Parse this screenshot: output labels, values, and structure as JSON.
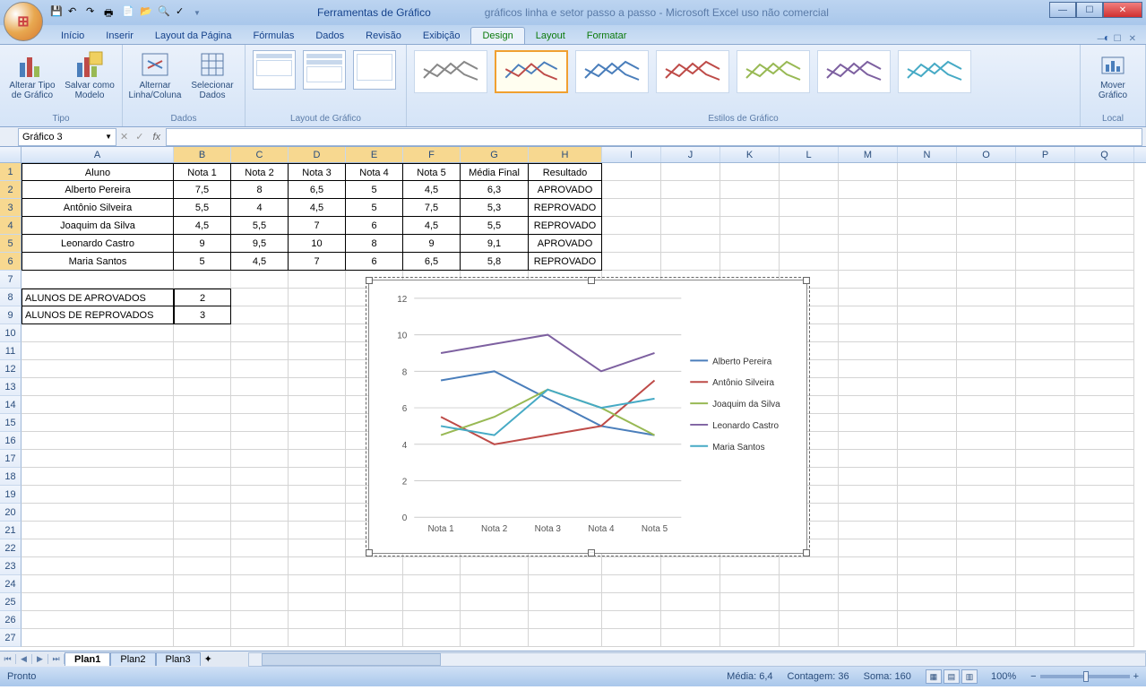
{
  "window": {
    "tools_title": "Ferramentas de Gráfico",
    "doc_title": "gráficos linha e setor passo a passo - Microsoft Excel uso não comercial"
  },
  "tabs": {
    "inicio": "Início",
    "inserir": "Inserir",
    "layout_pagina": "Layout da Página",
    "formulas": "Fórmulas",
    "dados": "Dados",
    "revisao": "Revisão",
    "exibicao": "Exibição",
    "design": "Design",
    "layout": "Layout",
    "formatar": "Formatar"
  },
  "ribbon": {
    "tipo": "Tipo",
    "alterar_tipo": "Alterar Tipo de Gráfico",
    "salvar_modelo": "Salvar como Modelo",
    "dados_lbl": "Dados",
    "alternar": "Alternar Linha/Coluna",
    "selecionar": "Selecionar Dados",
    "layout_grafico": "Layout de Gráfico",
    "estilos": "Estilos de Gráfico",
    "local": "Local",
    "mover": "Mover Gráfico"
  },
  "namebox": "Gráfico 3",
  "columns": [
    "A",
    "B",
    "C",
    "D",
    "E",
    "F",
    "G",
    "H",
    "I",
    "J",
    "K",
    "L",
    "M",
    "N",
    "O",
    "P",
    "Q"
  ],
  "grid": {
    "headers": [
      "Aluno",
      "Nota 1",
      "Nota 2",
      "Nota 3",
      "Nota 4",
      "Nota 5",
      "Média Final",
      "Resultado"
    ],
    "rows": [
      [
        "Alberto Pereira",
        "7,5",
        "8",
        "6,5",
        "5",
        "4,5",
        "6,3",
        "APROVADO"
      ],
      [
        "Antônio Silveira",
        "5,5",
        "4",
        "4,5",
        "5",
        "7,5",
        "5,3",
        "REPROVADO"
      ],
      [
        "Joaquim da Silva",
        "4,5",
        "5,5",
        "7",
        "6",
        "4,5",
        "5,5",
        "REPROVADO"
      ],
      [
        "Leonardo Castro",
        "9",
        "9,5",
        "10",
        "8",
        "9",
        "9,1",
        "APROVADO"
      ],
      [
        "Maria Santos",
        "5",
        "4,5",
        "7",
        "6",
        "6,5",
        "5,8",
        "REPROVADO"
      ]
    ],
    "summary": [
      [
        "ALUNOS DE APROVADOS",
        "2"
      ],
      [
        "ALUNOS DE REPROVADOS",
        "3"
      ]
    ]
  },
  "chart_data": {
    "type": "line",
    "categories": [
      "Nota 1",
      "Nota 2",
      "Nota 3",
      "Nota 4",
      "Nota 5"
    ],
    "series": [
      {
        "name": "Alberto Pereira",
        "values": [
          7.5,
          8,
          6.5,
          5,
          4.5
        ],
        "color": "#4a7ebb"
      },
      {
        "name": "Antônio Silveira",
        "values": [
          5.5,
          4,
          4.5,
          5,
          7.5
        ],
        "color": "#be4b48"
      },
      {
        "name": "Joaquim da Silva",
        "values": [
          4.5,
          5.5,
          7,
          6,
          4.5
        ],
        "color": "#98b954"
      },
      {
        "name": "Leonardo Castro",
        "values": [
          9,
          9.5,
          10,
          8,
          9
        ],
        "color": "#7d60a0"
      },
      {
        "name": "Maria Santos",
        "values": [
          5,
          4.5,
          7,
          6,
          6.5
        ],
        "color": "#46aac5"
      }
    ],
    "ylim": [
      0,
      12
    ],
    "yticks": [
      0,
      2,
      4,
      6,
      8,
      10,
      12
    ]
  },
  "sheets": {
    "plan1": "Plan1",
    "plan2": "Plan2",
    "plan3": "Plan3"
  },
  "status": {
    "ready": "Pronto",
    "media": "Média: 6,4",
    "contagem": "Contagem: 36",
    "soma": "Soma: 160",
    "zoom": "100%"
  }
}
